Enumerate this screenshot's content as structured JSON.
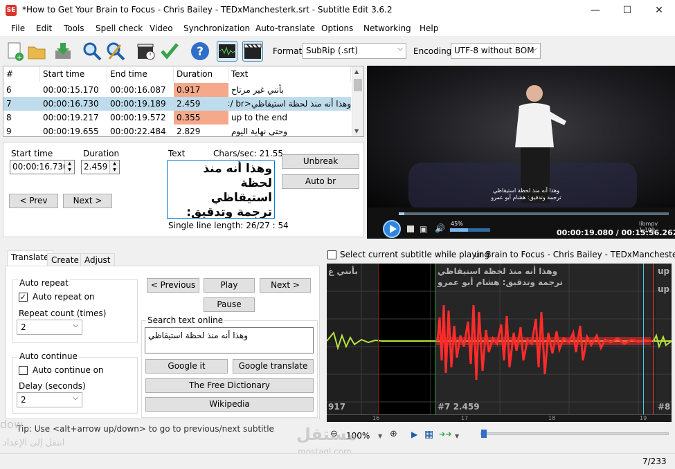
{
  "window": {
    "title": "*How to Get Your Brain to Focus - Chris Bailey - TEDxManchesterk.srt - Subtitle Edit 3.6.2",
    "app_icon_text": "SE"
  },
  "menu": [
    "File",
    "Edit",
    "Tools",
    "Spell check",
    "Video",
    "Synchronization",
    "Auto-translate",
    "Options",
    "Networking",
    "Help"
  ],
  "toolbar": {
    "format_label": "Format",
    "format_value": "SubRip (.srt)",
    "encoding_label": "Encoding",
    "encoding_value": "UTF-8 without BOM",
    "icons": [
      "new-file-icon",
      "open-folder-icon",
      "save-icon",
      "find-icon",
      "replace-icon",
      "visual-sync-icon",
      "spell-check-icon",
      "help-icon",
      "waveform-toggle-icon",
      "video-toggle-icon"
    ]
  },
  "subtitle_list": {
    "headers": [
      "#",
      "Start time",
      "End time",
      "Duration",
      "Text"
    ],
    "rows": [
      {
        "num": "6",
        "start": "00:00:15.170",
        "end": "00:00:16.087",
        "duration": "0.917",
        "text": "بأنني غير مرتاح",
        "warn": true
      },
      {
        "num": "7",
        "start": "00:00:16.730",
        "end": "00:00:19.189",
        "duration": "2.459",
        "text": "وهذا أنه منذ لحظة استيقاظي<br />",
        "warn": false,
        "selected": true
      },
      {
        "num": "8",
        "start": "00:00:19.217",
        "end": "00:00:19.572",
        "duration": "0.355",
        "text": "up to the end",
        "warn": true
      },
      {
        "num": "9",
        "start": "00:00:19.655",
        "end": "00:00:22.484",
        "duration": "2.829",
        "text": "وحتى نهاية اليوم",
        "warn": false
      }
    ]
  },
  "edit": {
    "start_time_label": "Start time",
    "start_time_value": "00:00:16.730",
    "duration_label": "Duration",
    "duration_value": "2.459",
    "text_label": "Text",
    "chars_sec": "Chars/sec: 21.55",
    "text_value": "وهذا أنه منذ لحظة\nاستيقاظي\nترجمة وتدقيق:\nهشام أبو عمرو",
    "single_line_length": "Single line length: 26/27 : 54",
    "prev_label": "< Prev",
    "next_label": "Next >",
    "unbreak_label": "Unbreak",
    "auto_br_label": "Auto br"
  },
  "video": {
    "subtitle_line1": "وهذا أنه منذ لحظة استيقاظي",
    "subtitle_line2": "ترجمة وتدقيق: هشام أبو عمرو",
    "volume": "45%",
    "volume_level": 0.45,
    "time": "00:00:19.080 / 00:15:56.262",
    "renderer": "libmpv 1.109",
    "progress": 0.02
  },
  "tabs": [
    "Translate",
    "Create",
    "Adjust"
  ],
  "translate": {
    "auto_repeat_group": "Auto repeat",
    "auto_repeat_on": "Auto repeat on",
    "repeat_count_label": "Repeat count (times)",
    "repeat_count_value": "2",
    "auto_continue_group": "Auto continue",
    "auto_continue_on": "Auto continue on",
    "delay_label": "Delay (seconds)",
    "delay_value": "2",
    "previous_label": "< Previous",
    "play_label": "Play",
    "next_label": "Next >",
    "pause_label": "Pause",
    "search_group": "Search text online",
    "search_text": "وهذا أنه منذ لحظة استيقاظي",
    "google_it": "Google it",
    "google_translate": "Google translate",
    "free_dictionary": "The Free Dictionary",
    "wikipedia": "Wikipedia",
    "tip": "Tip: Use <alt+arrow up/down> to go to previous/next subtitle"
  },
  "waveform": {
    "select_current_label": "Select current subtitle while playing",
    "video_name": "ur Brain to Focus - Chris Bailey - TEDxManchester.mkv",
    "prev_text": "بأنني غ",
    "current_line1": "وهذا أنه منذ لحظة استيقاظي",
    "current_line2": "ترجمة وتدقيق: هشام أبو عمرو",
    "next_text": "up",
    "next_text_bottom": "up",
    "left_marker": "917",
    "current_marker": "#7  2.459",
    "right_marker": "#8",
    "ticks": [
      "16",
      "17",
      "18",
      "19"
    ],
    "zoom": "100%"
  },
  "status": {
    "position": "7/233"
  },
  "watermark": {
    "arabic": "مستقل",
    "latin": "mostaql.com",
    "left_ar": "انتقل إلى الإعداد",
    "left_lat": "dow"
  }
}
